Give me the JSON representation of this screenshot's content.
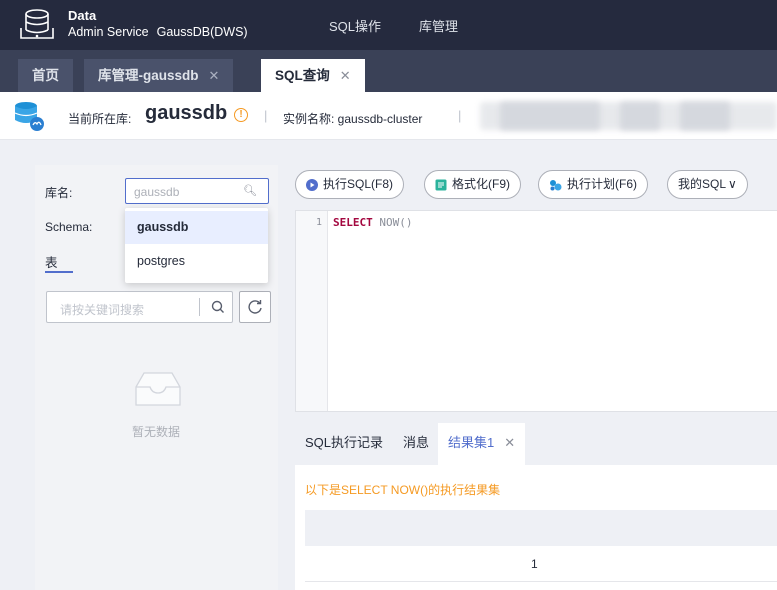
{
  "header": {
    "brand_title": "Data",
    "brand_sub": "Admin Service",
    "brand_product": "GaussDB(DWS)",
    "nav": [
      "SQL操作",
      "库管理"
    ]
  },
  "tabs": [
    {
      "label": "首页",
      "closable": false
    },
    {
      "label": "库管理-gaussdb",
      "closable": true
    },
    {
      "label": "SQL查询",
      "closable": true,
      "active": true
    }
  ],
  "info": {
    "current_db_label": "当前所在库:",
    "current_db": "gaussdb",
    "instance_label": "实例名称: gaussdb-cluster"
  },
  "left": {
    "db_label": "库名:",
    "db_value": "gaussdb",
    "schema_label": "Schema:",
    "table_tab": "表",
    "search_placeholder": "请按关键词搜索",
    "empty_text": "暂无数据",
    "db_options": [
      {
        "label": "gaussdb",
        "selected": true
      },
      {
        "label": "postgres",
        "selected": false
      }
    ]
  },
  "toolbar": {
    "run_label": "执行SQL(F8)",
    "format_label": "格式化(F9)",
    "plan_label": "执行计划(F6)",
    "mysql_label": "我的SQL"
  },
  "editor": {
    "line_no": "1",
    "keyword": "SELECT",
    "rest": " NOW()"
  },
  "result_tabs": [
    {
      "label": "SQL执行记录"
    },
    {
      "label": "消息"
    },
    {
      "label": "结果集1",
      "active": true
    }
  ],
  "result": {
    "hint": "以下是SELECT NOW()的执行结果集",
    "rows": [
      [
        "1"
      ]
    ]
  },
  "colors": {
    "topbar": "#252a3e",
    "accent": "#526ecc",
    "warning": "#f59a23"
  }
}
